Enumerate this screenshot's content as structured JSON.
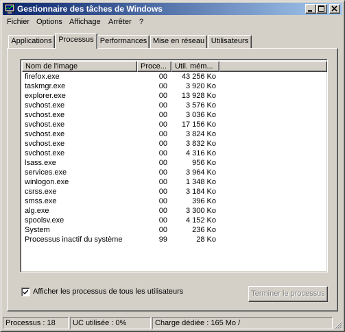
{
  "window": {
    "title": "Gestionnaire des tâches de Windows"
  },
  "menu": {
    "items": [
      "Fichier",
      "Options",
      "Affichage",
      "Arrêter",
      "?"
    ]
  },
  "tabs": [
    "Applications",
    "Processus",
    "Performances",
    "Mise en réseau",
    "Utilisateurs"
  ],
  "active_tab": "Processus",
  "list": {
    "columns": [
      "Nom de l'image",
      "Proce...",
      "Util. mém..."
    ],
    "rows": [
      {
        "name": "firefox.exe",
        "pid": "00",
        "mem": "43 256 Ko"
      },
      {
        "name": "taskmgr.exe",
        "pid": "00",
        "mem": "3 920 Ko"
      },
      {
        "name": "explorer.exe",
        "pid": "00",
        "mem": "13 928 Ko"
      },
      {
        "name": "svchost.exe",
        "pid": "00",
        "mem": "3 576 Ko"
      },
      {
        "name": "svchost.exe",
        "pid": "00",
        "mem": "3 036 Ko"
      },
      {
        "name": "svchost.exe",
        "pid": "00",
        "mem": "17 156 Ko"
      },
      {
        "name": "svchost.exe",
        "pid": "00",
        "mem": "3 824 Ko"
      },
      {
        "name": "svchost.exe",
        "pid": "00",
        "mem": "3 832 Ko"
      },
      {
        "name": "svchost.exe",
        "pid": "00",
        "mem": "4 316 Ko"
      },
      {
        "name": "lsass.exe",
        "pid": "00",
        "mem": "956 Ko"
      },
      {
        "name": "services.exe",
        "pid": "00",
        "mem": "3 964 Ko"
      },
      {
        "name": "winlogon.exe",
        "pid": "00",
        "mem": "1 348 Ko"
      },
      {
        "name": "csrss.exe",
        "pid": "00",
        "mem": "3 184 Ko"
      },
      {
        "name": "smss.exe",
        "pid": "00",
        "mem": "396 Ko"
      },
      {
        "name": "alg.exe",
        "pid": "00",
        "mem": "3 300 Ko"
      },
      {
        "name": "spoolsv.exe",
        "pid": "00",
        "mem": "4 152 Ko"
      },
      {
        "name": "System",
        "pid": "00",
        "mem": "236 Ko"
      },
      {
        "name": "Processus inactif du système",
        "pid": "99",
        "mem": "28 Ko"
      }
    ]
  },
  "options": {
    "show_all_users_label": "Afficher les processus de tous les utilisateurs",
    "show_all_users_checked": true
  },
  "buttons": {
    "end_process": "Terminer le processus"
  },
  "status": {
    "processes": "Processus : 18",
    "cpu": "UC utilisée : 0%",
    "commit": "Charge dédiée : 165 Mo /"
  },
  "colors": {
    "title_start": "#0a246a",
    "title_end": "#a6caf0",
    "face": "#d4d0c8"
  }
}
